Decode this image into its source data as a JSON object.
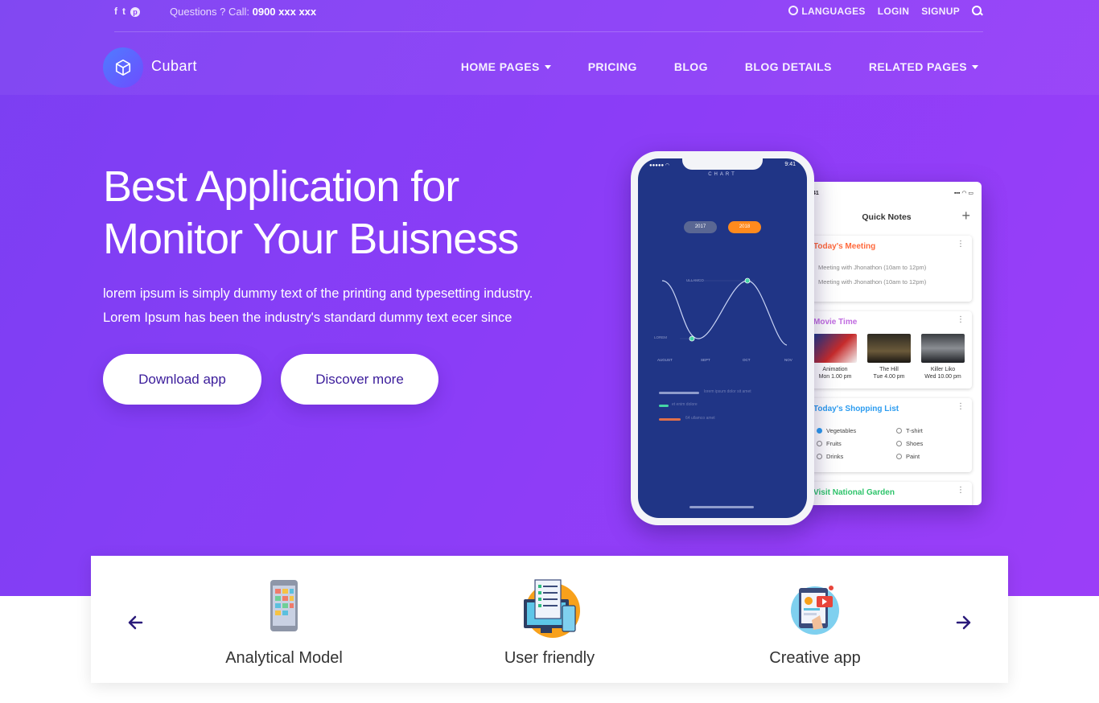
{
  "topbar": {
    "social": [
      "f",
      "t",
      "p"
    ],
    "question_prefix": "Questions ? Call: ",
    "phone": "0900 xxx xxx",
    "links": [
      "LANGUAGES",
      "LOGIN",
      "SIGNUP"
    ]
  },
  "brand": {
    "name": "Cubart",
    "icon": "cube-icon"
  },
  "nav": {
    "items": [
      "HOME PAGES",
      "PRICING",
      "BLOG",
      "BLOG DETAILS",
      "RELATED PAGES"
    ]
  },
  "hero": {
    "headline_line1": "Best Application for",
    "headline_line2": "Monitor Your Buisness",
    "desc_line1": "lorem ipsum is simply dummy text of the printing and typesetting industry.",
    "desc_line2": "Lorem Ipsum has been the industry's standard dummy text ecer since",
    "btn_download": "Download app",
    "btn_discover": "Discover more"
  },
  "phone": {
    "status_time": "9:41",
    "screen_title": "CHART",
    "years": [
      "2017",
      "2018"
    ],
    "months": [
      "AUGUST",
      "SEPT",
      "OCT",
      "NOV"
    ],
    "labels": [
      "LOREM",
      "ULLAMCO"
    ],
    "legend": [
      "lorem ipsum dolor sit amet",
      "et enim dolore",
      "64 ullamco amet"
    ]
  },
  "notes": {
    "status_time": "41",
    "title": "Quick Notes",
    "meeting": {
      "title": "Today's Meeting",
      "items": [
        "Meeting with Jhonathon (10am to 12pm)",
        "Meeting with Jhonathon (10am to 12pm)"
      ]
    },
    "movies": {
      "title": "Movie Time",
      "items": [
        {
          "name": "Animation",
          "time": "Mon 1.00 pm"
        },
        {
          "name": "The Hill",
          "time": "Tue 4.00 pm"
        },
        {
          "name": "Killer Liko",
          "time": "Wed 10.00 pm"
        }
      ]
    },
    "shopping": {
      "title": "Today's Shopping List",
      "left": [
        "Vegetables",
        "Fruits",
        "Drinks"
      ],
      "right": [
        "T-shirt",
        "Shoes",
        "Paint"
      ]
    },
    "garden": {
      "title": "Visit National Garden"
    }
  },
  "features": [
    {
      "label": "Analytical Model",
      "icon": "mobile-app-icon"
    },
    {
      "label": "User friendly",
      "icon": "monitor-checklist-icon"
    },
    {
      "label": "Creative app",
      "icon": "tablet-media-icon"
    }
  ],
  "colors": {
    "hero_start": "#7b3ff2",
    "hero_end": "#9b3ef8",
    "button_text": "#3b1c9b",
    "phone_screen": "#203586",
    "accent_orange": "#ff8a1d",
    "meeting": "#ff6a3d",
    "movie": "#c06be0",
    "shopping": "#2c9cf0",
    "garden": "#2ec46b"
  }
}
